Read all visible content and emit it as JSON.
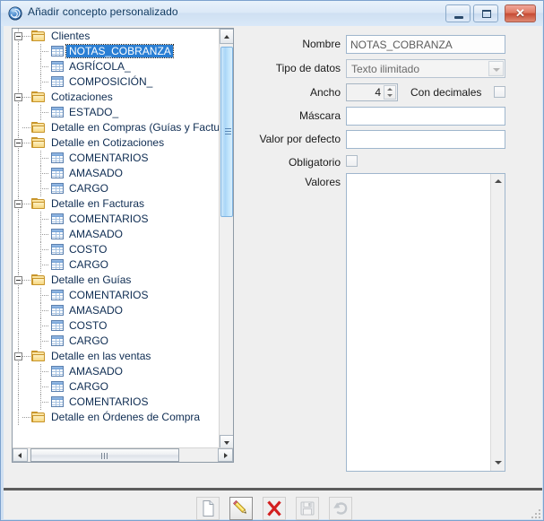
{
  "window": {
    "title": "Añadir concepto personalizado",
    "icon": "spiral-app-icon",
    "controls": {
      "minimize": "Minimizar",
      "maximize": "Maximizar",
      "close": "Cerrar",
      "close_glyph": "✕"
    },
    "accent_color": "#2a7fd4",
    "titlebar_color": "#dce9f7",
    "close_color": "#c64b34"
  },
  "tree": {
    "selected": "NOTAS_COBRANZA",
    "rows": [
      {
        "label": "Clientes",
        "type": "folder",
        "depth": 0,
        "expanded": true,
        "has_toggle": true
      },
      {
        "label": "NOTAS_COBRANZA",
        "type": "grid",
        "depth": 1,
        "selected": true
      },
      {
        "label": "AGRÍCOLA_",
        "type": "grid",
        "depth": 1
      },
      {
        "label": "COMPOSICIÓN_",
        "type": "grid",
        "depth": 1
      },
      {
        "label": "Cotizaciones",
        "type": "folder",
        "depth": 0,
        "expanded": true,
        "has_toggle": true
      },
      {
        "label": "ESTADO_",
        "type": "grid",
        "depth": 1
      },
      {
        "label": "Detalle en Compras (Guías y Facturas)",
        "type": "folder",
        "depth": 0,
        "expanded": false,
        "has_toggle": false,
        "truncated": true
      },
      {
        "label": "Detalle en Cotizaciones",
        "type": "folder",
        "depth": 0,
        "expanded": true,
        "has_toggle": true
      },
      {
        "label": "COMENTARIOS",
        "type": "grid",
        "depth": 1
      },
      {
        "label": "AMASADO",
        "type": "grid",
        "depth": 1
      },
      {
        "label": "CARGO",
        "type": "grid",
        "depth": 1
      },
      {
        "label": "Detalle en Facturas",
        "type": "folder",
        "depth": 0,
        "expanded": true,
        "has_toggle": true
      },
      {
        "label": "COMENTARIOS",
        "type": "grid",
        "depth": 1
      },
      {
        "label": "AMASADO",
        "type": "grid",
        "depth": 1
      },
      {
        "label": "COSTO",
        "type": "grid",
        "depth": 1
      },
      {
        "label": "CARGO",
        "type": "grid",
        "depth": 1
      },
      {
        "label": "Detalle en Guías",
        "type": "folder",
        "depth": 0,
        "expanded": true,
        "has_toggle": true
      },
      {
        "label": "COMENTARIOS",
        "type": "grid",
        "depth": 1
      },
      {
        "label": "AMASADO",
        "type": "grid",
        "depth": 1
      },
      {
        "label": "COSTO",
        "type": "grid",
        "depth": 1
      },
      {
        "label": "CARGO",
        "type": "grid",
        "depth": 1
      },
      {
        "label": "Detalle en las ventas",
        "type": "folder",
        "depth": 0,
        "expanded": true,
        "has_toggle": true
      },
      {
        "label": "AMASADO",
        "type": "grid",
        "depth": 1
      },
      {
        "label": "CARGO",
        "type": "grid",
        "depth": 1
      },
      {
        "label": "COMENTARIOS",
        "type": "grid",
        "depth": 1
      },
      {
        "label": "Detalle en Órdenes de Compra",
        "type": "folder",
        "depth": 0,
        "expanded": false,
        "has_toggle": false,
        "clipped": true
      }
    ]
  },
  "form": {
    "nombre": {
      "label": "Nombre",
      "value": "NOTAS_COBRANZA"
    },
    "tipo_datos": {
      "label": "Tipo de datos",
      "value": "Texto ilimitado",
      "options": [
        "Texto ilimitado"
      ],
      "enabled": false
    },
    "ancho": {
      "label": "Ancho",
      "value": "4"
    },
    "con_decimales": {
      "label": "Con decimales",
      "checked": false
    },
    "mascara": {
      "label": "Máscara",
      "value": "",
      "placeholder": ""
    },
    "valor_por_defecto": {
      "label": "Valor por defecto",
      "value": "",
      "placeholder": ""
    },
    "obligatorio": {
      "label": "Obligatorio",
      "checked": false
    },
    "valores": {
      "label": "Valores",
      "value": "",
      "placeholder": ""
    }
  },
  "toolbar": {
    "buttons": [
      {
        "name": "new",
        "icon": "new-document-icon",
        "label": "Nuevo",
        "enabled": true,
        "hot": false
      },
      {
        "name": "edit",
        "icon": "pencil-icon",
        "label": "Editar",
        "enabled": true,
        "hot": true
      },
      {
        "name": "delete",
        "icon": "red-x-icon",
        "label": "Eliminar",
        "enabled": true,
        "hot": false
      },
      {
        "name": "save",
        "icon": "floppy-disk-icon",
        "label": "Guardar",
        "enabled": false,
        "hot": false
      },
      {
        "name": "undo",
        "icon": "undo-arrow-icon",
        "label": "Deshacer",
        "enabled": false,
        "hot": false
      }
    ]
  },
  "scrollbars": {
    "tree_vertical": {
      "position": 4
    },
    "tree_horizontal": {
      "position": 12
    },
    "valores_vertical": {
      "position": 0
    }
  }
}
